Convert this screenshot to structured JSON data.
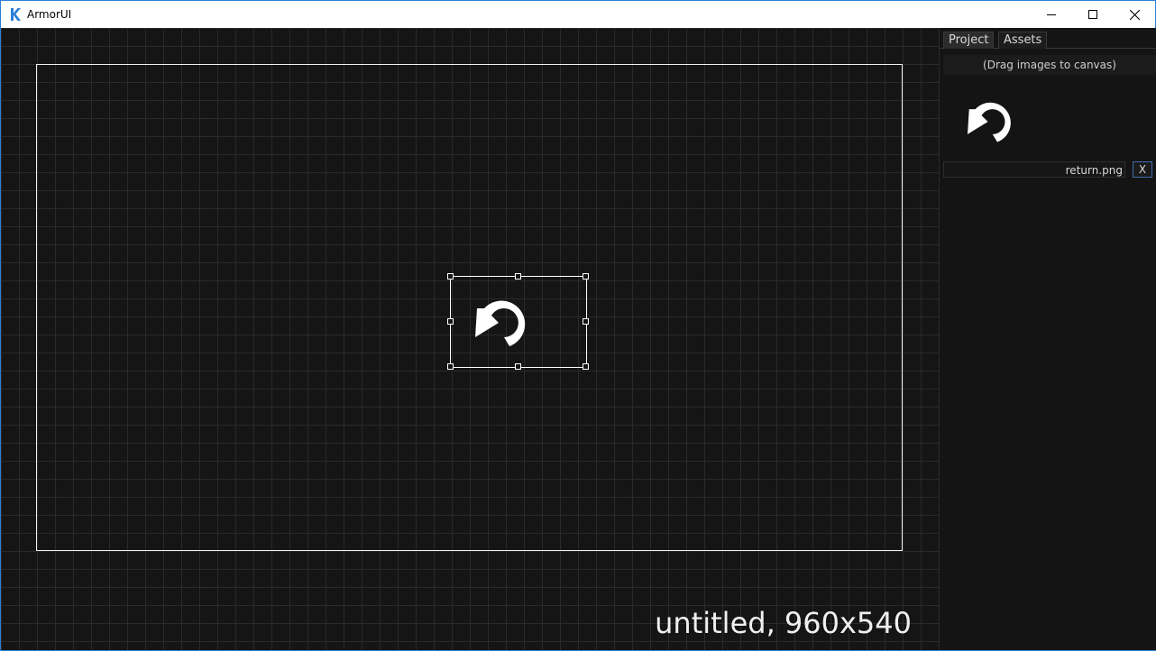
{
  "window": {
    "title": "ArmorUI",
    "logo_icon": "armorui-k-logo",
    "controls": [
      "minimize-icon",
      "maximize-icon",
      "close-icon"
    ],
    "accent_color": "#2b7fd6"
  },
  "canvas": {
    "info": "untitled, 960x540",
    "background": "#151515",
    "grid_color": "#2a2a2a",
    "selected_image_icon": "return-arrow-icon"
  },
  "panel": {
    "tabs": [
      {
        "label": "Project",
        "active": true
      },
      {
        "label": "Assets",
        "active": false
      }
    ],
    "hint": "(Drag images to canvas)",
    "assets": [
      {
        "name": "return.png",
        "thumb_icon": "return-arrow-icon",
        "remove_label": "X"
      }
    ]
  }
}
